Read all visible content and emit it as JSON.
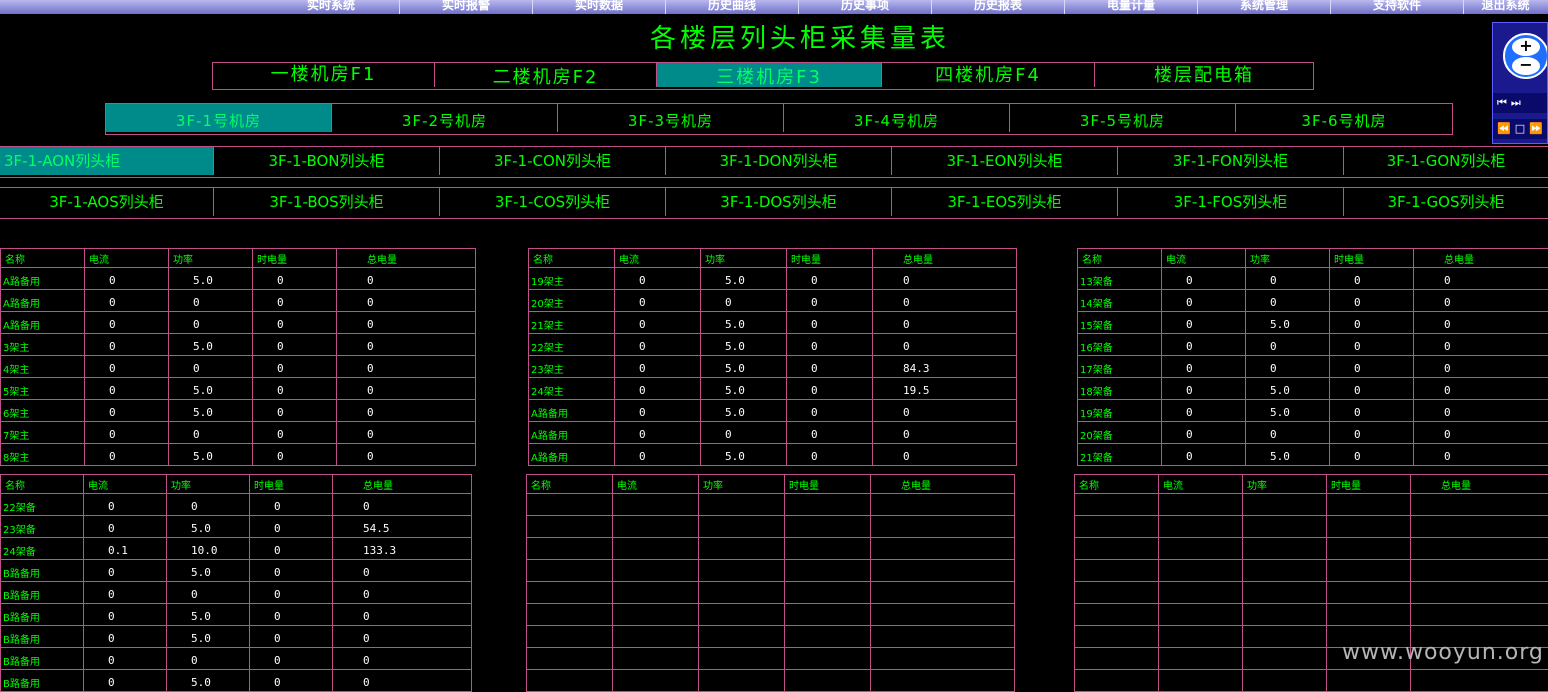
{
  "menu": [
    "实时系统",
    "实时报警",
    "实时数据",
    "历史曲线",
    "历史事项",
    "历史报表",
    "电量计量",
    "系统管理",
    "支持软件",
    "退出系统"
  ],
  "title": "各楼层列头柜采集量表",
  "floor_tabs": [
    "一楼机房F1",
    "二楼机房F2",
    "三楼机房F3",
    "四楼机房F4",
    "楼层配电箱"
  ],
  "room_tabs": [
    "3F-1号机房",
    "3F-2号机房",
    "3F-3号机房",
    "3F-4号机房",
    "3F-5号机房",
    "3F-6号机房"
  ],
  "cabinet_tabs_n": [
    "3F-1-AON列头柜",
    "3F-1-BON列头柜",
    "3F-1-CON列头柜",
    "3F-1-DON列头柜",
    "3F-1-EON列头柜",
    "3F-1-FON列头柜",
    "3F-1-GON列头柜"
  ],
  "cabinet_tabs_s": [
    "3F-1-AOS列头柜",
    "3F-1-BOS列头柜",
    "3F-1-COS列头柜",
    "3F-1-DOS列头柜",
    "3F-1-EOS列头柜",
    "3F-1-FOS列头柜",
    "3F-1-GOS列头柜"
  ],
  "columns": [
    "名称",
    "电流",
    "功率",
    "时电量",
    "总电量"
  ],
  "tables": [
    {
      "rows": [
        [
          "A路备用",
          "0",
          "5.0",
          "0",
          "0"
        ],
        [
          "A路备用",
          "0",
          "0",
          "0",
          "0"
        ],
        [
          "A路备用",
          "0",
          "0",
          "0",
          "0"
        ],
        [
          "3架主",
          "0",
          "5.0",
          "0",
          "0"
        ],
        [
          "4架主",
          "0",
          "0",
          "0",
          "0"
        ],
        [
          "5架主",
          "0",
          "5.0",
          "0",
          "0"
        ],
        [
          "6架主",
          "0",
          "5.0",
          "0",
          "0"
        ],
        [
          "7架主",
          "0",
          "0",
          "0",
          "0"
        ],
        [
          "8架主",
          "0",
          "5.0",
          "0",
          "0"
        ]
      ]
    },
    {
      "rows": [
        [
          "19架主",
          "0",
          "5.0",
          "0",
          "0"
        ],
        [
          "20架主",
          "0",
          "0",
          "0",
          "0"
        ],
        [
          "21架主",
          "0",
          "5.0",
          "0",
          "0"
        ],
        [
          "22架主",
          "0",
          "5.0",
          "0",
          "0"
        ],
        [
          "23架主",
          "0",
          "5.0",
          "0",
          "84.3"
        ],
        [
          "24架主",
          "0",
          "5.0",
          "0",
          "19.5"
        ],
        [
          "A路备用",
          "0",
          "5.0",
          "0",
          "0"
        ],
        [
          "A路备用",
          "0",
          "0",
          "0",
          "0"
        ],
        [
          "A路备用",
          "0",
          "5.0",
          "0",
          "0"
        ]
      ]
    },
    {
      "rows": [
        [
          "13架备",
          "0",
          "0",
          "0",
          "0"
        ],
        [
          "14架备",
          "0",
          "0",
          "0",
          "0"
        ],
        [
          "15架备",
          "0",
          "5.0",
          "0",
          "0"
        ],
        [
          "16架备",
          "0",
          "0",
          "0",
          "0"
        ],
        [
          "17架备",
          "0",
          "0",
          "0",
          "0"
        ],
        [
          "18架备",
          "0",
          "5.0",
          "0",
          "0"
        ],
        [
          "19架备",
          "0",
          "5.0",
          "0",
          "0"
        ],
        [
          "20架备",
          "0",
          "0",
          "0",
          "0"
        ],
        [
          "21架备",
          "0",
          "5.0",
          "0",
          "0"
        ]
      ]
    },
    {
      "rows": [
        [
          "22架备",
          "0",
          "0",
          "0",
          "0"
        ],
        [
          "23架备",
          "0",
          "5.0",
          "0",
          "54.5"
        ],
        [
          "24架备",
          "0.1",
          "10.0",
          "0",
          "133.3"
        ],
        [
          "B路备用",
          "0",
          "5.0",
          "0",
          "0"
        ],
        [
          "B路备用",
          "0",
          "0",
          "0",
          "0"
        ],
        [
          "B路备用",
          "0",
          "5.0",
          "0",
          "0"
        ],
        [
          "B路备用",
          "0",
          "5.0",
          "0",
          "0"
        ],
        [
          "B路备用",
          "0",
          "0",
          "0",
          "0"
        ],
        [
          "B路备用",
          "0",
          "5.0",
          "0",
          "0"
        ]
      ]
    },
    {
      "rows": [
        [
          "",
          "",
          "",
          "",
          ""
        ],
        [
          "",
          "",
          "",
          "",
          ""
        ],
        [
          "",
          "",
          "",
          "",
          ""
        ],
        [
          "",
          "",
          "",
          "",
          ""
        ],
        [
          "",
          "",
          "",
          "",
          ""
        ],
        [
          "",
          "",
          "",
          "",
          ""
        ],
        [
          "",
          "",
          "",
          "",
          ""
        ],
        [
          "",
          "",
          "",
          "",
          ""
        ],
        [
          "",
          "",
          "",
          "",
          ""
        ]
      ]
    },
    {
      "rows": [
        [
          "",
          "",
          "",
          "",
          ""
        ],
        [
          "",
          "",
          "",
          "",
          ""
        ],
        [
          "",
          "",
          "",
          "",
          ""
        ],
        [
          "",
          "",
          "",
          "",
          ""
        ],
        [
          "",
          "",
          "",
          "",
          ""
        ],
        [
          "",
          "",
          "",
          "",
          ""
        ],
        [
          "",
          "",
          "",
          "",
          ""
        ],
        [
          "",
          "",
          "",
          "",
          ""
        ],
        [
          "",
          "",
          "",
          "",
          ""
        ]
      ]
    }
  ],
  "nav_widget": {
    "zoom_in": "+",
    "zoom_out": "−",
    "row1": "⏮⏭",
    "row2": "⏪□⏩"
  },
  "watermark": "www.wooyun.org"
}
